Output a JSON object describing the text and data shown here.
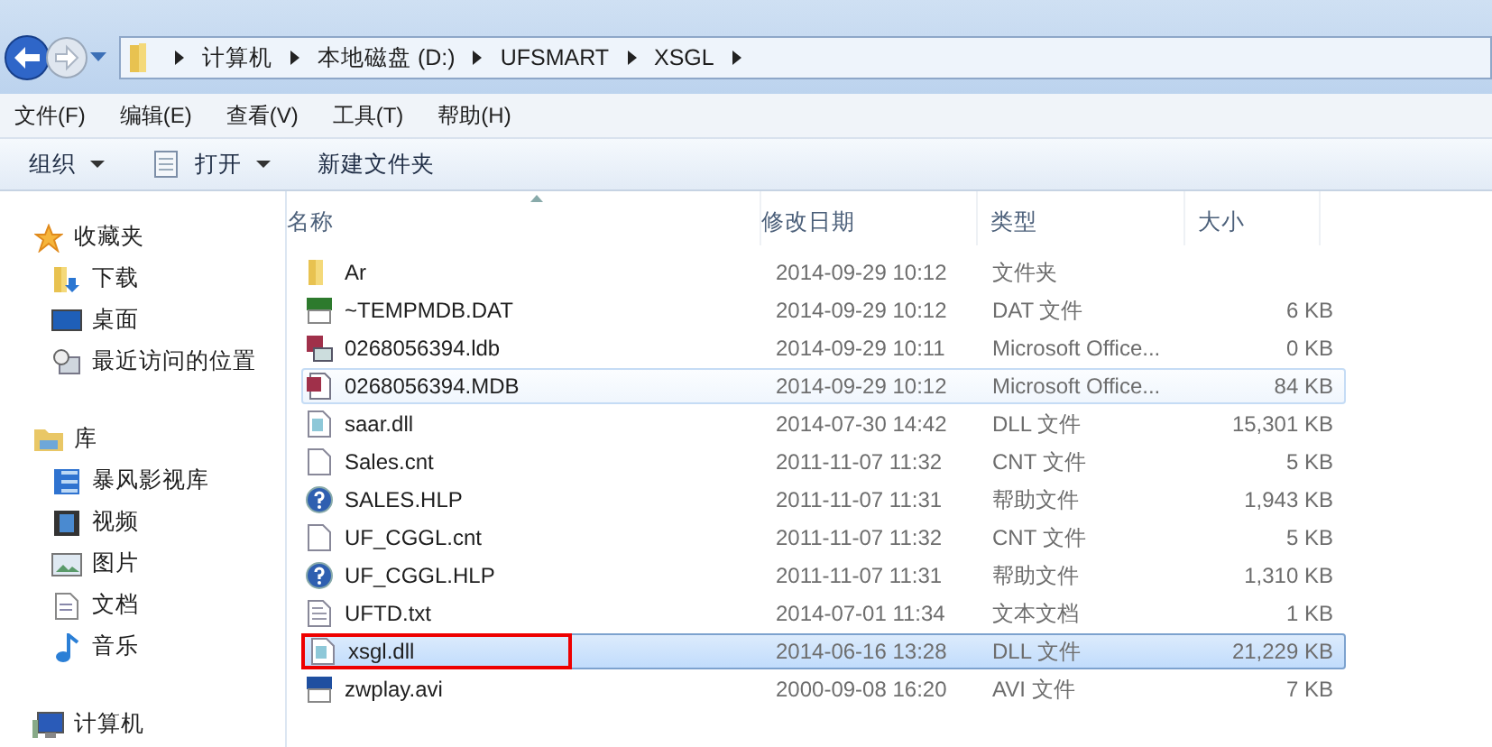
{
  "address": {
    "crumbs": [
      "计算机",
      "本地磁盘 (D:)",
      "UFSMART",
      "XSGL"
    ]
  },
  "menu": [
    "文件(F)",
    "编辑(E)",
    "查看(V)",
    "工具(T)",
    "帮助(H)"
  ],
  "toolbar": [
    {
      "label": "组织",
      "dropdown": true,
      "kind": "menu"
    },
    {
      "label": "打开",
      "dropdown": true,
      "kind": "open"
    },
    {
      "label": "新建文件夹",
      "dropdown": false,
      "kind": "plain"
    }
  ],
  "sidebar": [
    {
      "label": "收藏夹",
      "kind": "favorites",
      "children": [
        {
          "label": "下载",
          "kind": "download"
        },
        {
          "label": "桌面",
          "kind": "desktop"
        },
        {
          "label": "最近访问的位置",
          "kind": "recent"
        }
      ]
    },
    {
      "label": "库",
      "kind": "library",
      "children": [
        {
          "label": "暴风影视库",
          "kind": "film"
        },
        {
          "label": "视频",
          "kind": "video"
        },
        {
          "label": "图片",
          "kind": "picture"
        },
        {
          "label": "文档",
          "kind": "doc"
        },
        {
          "label": "音乐",
          "kind": "music"
        }
      ]
    },
    {
      "label": "计算机",
      "kind": "computer"
    }
  ],
  "columns": [
    "名称",
    "修改日期",
    "类型",
    "大小"
  ],
  "rows": [
    {
      "name": "Ar",
      "date": "2014-09-29 10:12",
      "type": "文件夹",
      "kind": "folder",
      "selected": false,
      "hovered": false,
      "marked": false
    },
    {
      "name": "~TEMPMDB.DAT",
      "date": "2014-09-29 10:12",
      "type": "DAT 文件",
      "size": "6 KB",
      "kind": "dat",
      "selected": false,
      "hovered": false,
      "marked": false
    },
    {
      "name": "0268056394.ldb",
      "date": "2014-09-29 10:11",
      "type": "Microsoft Office...",
      "size": "0 KB",
      "kind": "ldb",
      "selected": false,
      "hovered": false,
      "marked": false
    },
    {
      "name": "0268056394.MDB",
      "date": "2014-09-29 10:12",
      "type": "Microsoft Office...",
      "size": "84 KB",
      "kind": "mdb",
      "selected": false,
      "hovered": true,
      "marked": false
    },
    {
      "name": "saar.dll",
      "date": "2014-07-30 14:42",
      "type": "DLL 文件",
      "size": "15,301 KB",
      "kind": "dll",
      "selected": false,
      "hovered": false,
      "marked": false
    },
    {
      "name": "Sales.cnt",
      "date": "2011-11-07 11:32",
      "type": "CNT 文件",
      "size": "5 KB",
      "kind": "blank",
      "selected": false,
      "hovered": false,
      "marked": false
    },
    {
      "name": "SALES.HLP",
      "date": "2011-11-07 11:31",
      "type": "帮助文件",
      "size": "1,943 KB",
      "kind": "help",
      "selected": false,
      "hovered": false,
      "marked": false
    },
    {
      "name": "UF_CGGL.cnt",
      "date": "2011-11-07 11:32",
      "type": "CNT 文件",
      "size": "5 KB",
      "kind": "blank",
      "selected": false,
      "hovered": false,
      "marked": false
    },
    {
      "name": "UF_CGGL.HLP",
      "date": "2011-11-07 11:31",
      "type": "帮助文件",
      "size": "1,310 KB",
      "kind": "help",
      "selected": false,
      "hovered": false,
      "marked": false
    },
    {
      "name": "UFTD.txt",
      "date": "2014-07-01 11:34",
      "type": "文本文档",
      "size": "1 KB",
      "kind": "txt",
      "selected": false,
      "hovered": false,
      "marked": false
    },
    {
      "name": "xsgl.dll",
      "date": "2014-06-16 13:28",
      "type": "DLL 文件",
      "size": "21,229 KB",
      "kind": "dll",
      "selected": true,
      "hovered": false,
      "marked": true
    },
    {
      "name": "zwplay.avi",
      "date": "2000-09-08 16:20",
      "type": "AVI 文件",
      "size": "7 KB",
      "kind": "avi",
      "selected": false,
      "hovered": false,
      "marked": false
    }
  ]
}
